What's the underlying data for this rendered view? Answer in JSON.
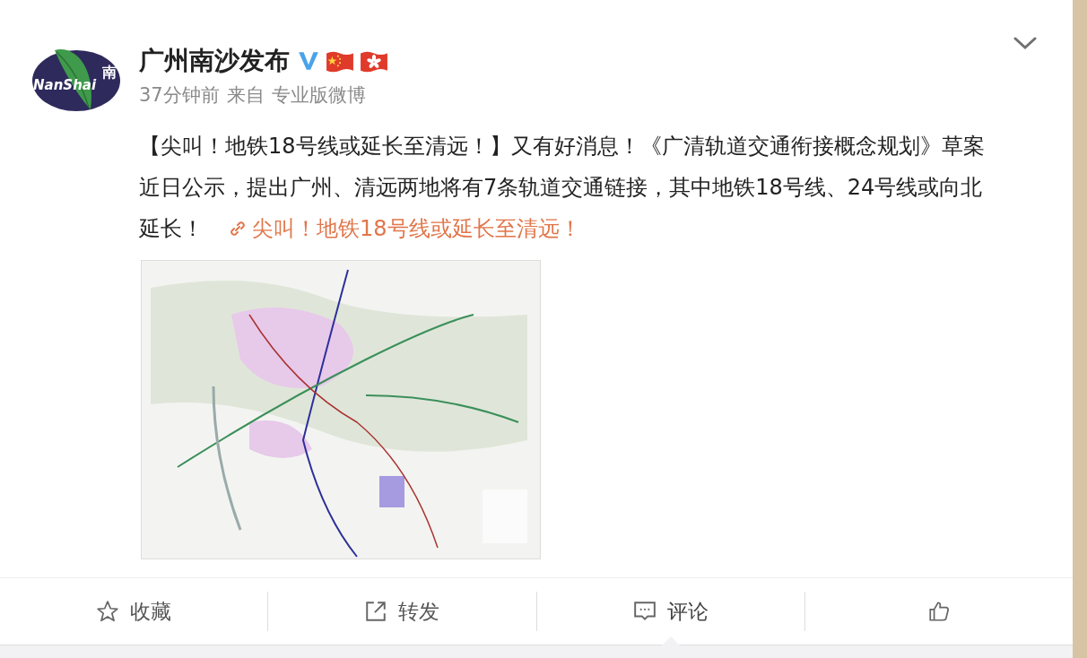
{
  "author": {
    "name": "广州南沙发布",
    "verified": true,
    "avatar_text": "NanShai",
    "avatar_glyph": "南",
    "time": "37分钟前",
    "source_prefix": "来自",
    "source": "专业版微博"
  },
  "post": {
    "text": "【尖叫！地铁18号线或延长至清远！】又有好消息！《广清轨道交通衔接概念规划》草案近日公示，提出广州、清远两地将有7条轨道交通链接，其中地铁18号线、24号线或向北延长！",
    "link": "尖叫！地铁18号线或延长至清远！"
  },
  "actions": [
    {
      "kind": "star",
      "label": "收藏",
      "selected": false
    },
    {
      "kind": "share",
      "label": "转发",
      "selected": false
    },
    {
      "kind": "comment",
      "label": "评论",
      "selected": true
    },
    {
      "kind": "like",
      "selected": false
    }
  ]
}
